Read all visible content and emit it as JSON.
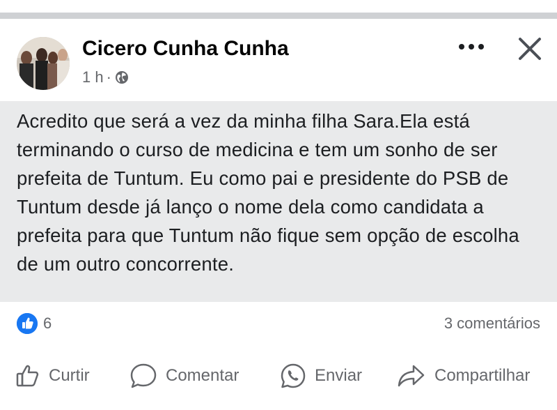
{
  "post": {
    "author": "Cicero Cunha Cunha",
    "time": "1 h",
    "separator": "·",
    "privacy_icon": "globe-icon",
    "text": "Acredito que será a vez da minha filha Sara.Ela está terminando o curso de medicina e tem um sonho de ser prefeita de Tuntum. Eu como pai e presidente do PSB de Tuntum desde já lanço o nome dela como candidata a prefeita para que Tuntum não fique sem opção de escolha de um outro concorrente."
  },
  "stats": {
    "likes": "6",
    "comments": "3 comentários"
  },
  "actions": {
    "like": "Curtir",
    "comment": "Comentar",
    "send": "Enviar",
    "share": "Compartilhar"
  },
  "colors": {
    "brand_blue": "#1877f2",
    "text_highlight_bg": "#e9eaeb",
    "secondary_text": "#65676b"
  }
}
